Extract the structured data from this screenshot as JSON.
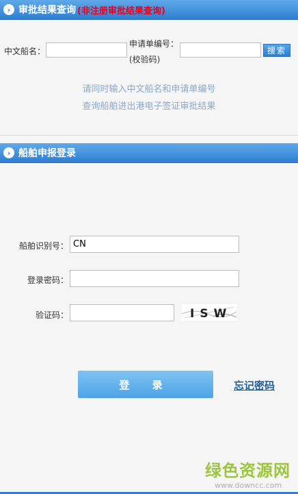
{
  "query_section": {
    "title": "审批结果查询",
    "subtitle": "(非注册审批结果查询)",
    "ship_name_label": "中文船名：",
    "ship_name_value": "",
    "app_no_label_line1": "申请单编号：",
    "app_no_label_line2": "(校验码)",
    "app_no_value": "",
    "search_label": "搜索",
    "hint_line1": "请同时输入中文船名和申请单编号",
    "hint_line2": "查询船舶进出港电子签证审批结果"
  },
  "login_section": {
    "title": "船舶申报登录",
    "ship_id_label": "船舶识别号：",
    "ship_id_value": "CN",
    "password_label": "登录密码：",
    "password_value": "",
    "captcha_label": "验证码：",
    "captcha_value": "",
    "captcha_text": "ISW",
    "login_label": "登 录",
    "forgot_label": "忘记密码"
  },
  "watermark": {
    "main": "绿色资源网",
    "sub": "www.downcc.com"
  },
  "colors": {
    "header_blue": "#2f7fd1",
    "subtitle_red": "#e8001c",
    "hint_blue": "#8aa8c8",
    "login_button": "#5aaeea",
    "forgot_link": "#1f5e9e",
    "watermark_green": "#9bc63b"
  }
}
